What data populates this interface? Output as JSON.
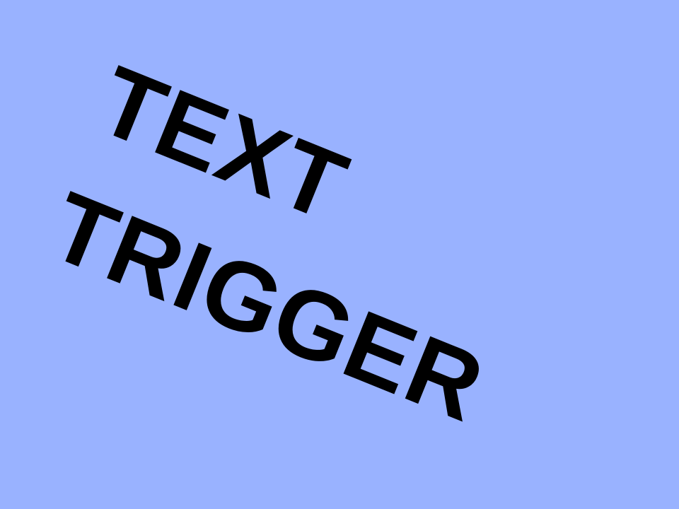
{
  "background_color": "#99b2ff",
  "text_color": "#000000",
  "lines": [
    "TEXT",
    "TRIGGER"
  ]
}
